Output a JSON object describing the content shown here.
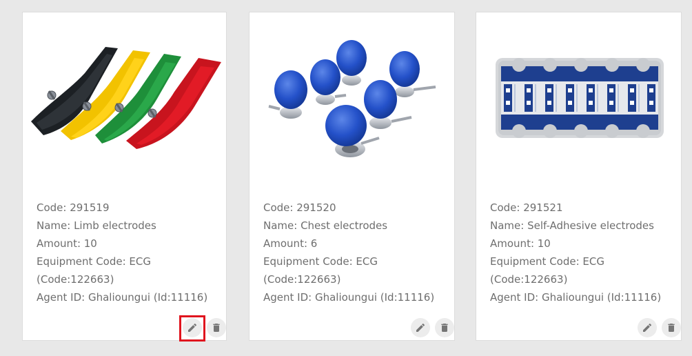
{
  "cards": [
    {
      "code": "Code: 291519",
      "name": "Name: Limb electrodes",
      "amount": "Amount: 10",
      "equipment_line1": "Equipment Code: ECG",
      "equipment_line2": "(Code:122663)",
      "agent": "Agent ID: Ghalioungui (Id:11116)",
      "image_icon": "limb-electrodes-image",
      "edit_highlighted": true
    },
    {
      "code": "Code: 291520",
      "name": "Name: Chest electrodes",
      "amount": "Amount: 6",
      "equipment_line1": "Equipment Code: ECG",
      "equipment_line2": "(Code:122663)",
      "agent": "Agent ID: Ghalioungui (Id:11116)",
      "image_icon": "chest-electrodes-image",
      "edit_highlighted": false
    },
    {
      "code": "Code: 291521",
      "name": "Name: Self-Adhesive electrodes",
      "amount": "Amount: 10",
      "equipment_line1": "Equipment Code: ECG",
      "equipment_line2": "(Code:122663)",
      "agent": "Agent ID: Ghalioungui (Id:11116)",
      "image_icon": "self-adhesive-electrodes-image",
      "edit_highlighted": false
    }
  ],
  "icons": {
    "edit": "pencil-icon",
    "delete": "trash-icon"
  },
  "colors": {
    "text": "#6e6e6e",
    "button_bg": "#ececec",
    "icon": "#757575",
    "highlight": "#e0141e",
    "background": "#e8e8e8"
  }
}
